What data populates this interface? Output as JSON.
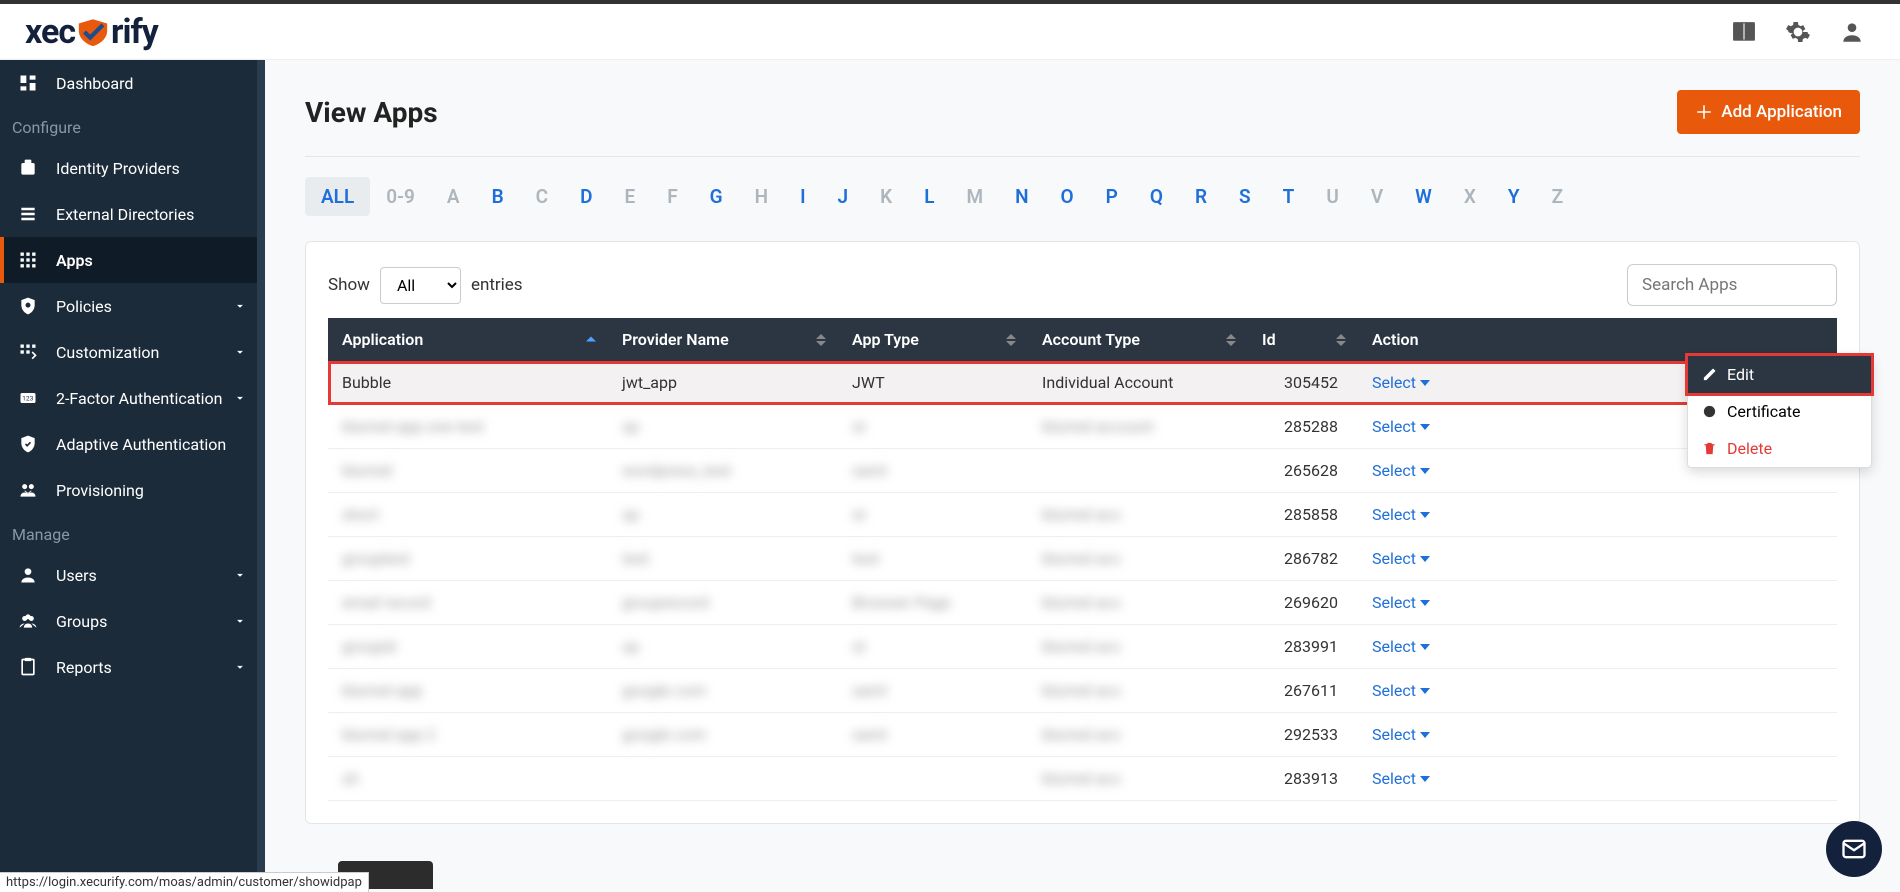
{
  "brand": "xecurify",
  "page": {
    "title": "View Apps",
    "add_btn": "Add Application"
  },
  "sidebar": {
    "items": [
      {
        "label": "Dashboard",
        "name": "dashboard"
      },
      {
        "section": "Configure"
      },
      {
        "label": "Identity Providers",
        "name": "identity-providers"
      },
      {
        "label": "External Directories",
        "name": "external-directories"
      },
      {
        "label": "Apps",
        "name": "apps",
        "active": true
      },
      {
        "label": "Policies",
        "name": "policies",
        "expandable": true
      },
      {
        "label": "Customization",
        "name": "customization",
        "expandable": true
      },
      {
        "label": "2-Factor Authentication",
        "name": "two-factor",
        "expandable": true
      },
      {
        "label": "Adaptive Authentication",
        "name": "adaptive-auth"
      },
      {
        "label": "Provisioning",
        "name": "provisioning"
      },
      {
        "section": "Manage"
      },
      {
        "label": "Users",
        "name": "users",
        "expandable": true
      },
      {
        "label": "Groups",
        "name": "groups",
        "expandable": true
      },
      {
        "label": "Reports",
        "name": "reports",
        "expandable": true
      }
    ]
  },
  "alpha": {
    "items": [
      "ALL",
      "0-9",
      "A",
      "B",
      "C",
      "D",
      "E",
      "F",
      "G",
      "H",
      "I",
      "J",
      "K",
      "L",
      "M",
      "N",
      "O",
      "P",
      "Q",
      "R",
      "S",
      "T",
      "U",
      "V",
      "W",
      "X",
      "Y",
      "Z"
    ],
    "selected": "ALL",
    "disabled": [
      "0-9",
      "A",
      "C",
      "E",
      "F",
      "H",
      "K",
      "M",
      "U",
      "V",
      "X",
      "Z"
    ]
  },
  "table": {
    "show_label": "Show",
    "entries_label": "entries",
    "show_value": "All",
    "search_placeholder": "Search Apps",
    "headers": [
      "Application",
      "Provider Name",
      "App Type",
      "Account Type",
      "Id",
      "Action"
    ],
    "select_label": "Select",
    "rows": [
      {
        "app": "Bubble",
        "provider": "jwt_app",
        "type": "JWT",
        "account": "Individual Account",
        "id": "305452",
        "hl": true
      },
      {
        "app": "blurred app one text",
        "provider": "sp",
        "type": "st",
        "account": "blurred account",
        "id": "285288",
        "b": true
      },
      {
        "app": "blurred",
        "provider": "wordpress_test",
        "type": "saml",
        "account": "",
        "id": "265628",
        "b": true
      },
      {
        "app": "short",
        "provider": "sp",
        "type": "st",
        "account": "blurred acc",
        "id": "285858",
        "b": true
      },
      {
        "app": "grouptext",
        "provider": "test",
        "type": "test",
        "account": "blurred acc",
        "id": "286782",
        "b": true
      },
      {
        "app": "email record",
        "provider": "grouprecord",
        "type": "Browser Page",
        "account": "blurred acc",
        "id": "269620",
        "b": true
      },
      {
        "app": "groupid",
        "provider": "sp",
        "type": "st",
        "account": "blurred acc",
        "id": "283991",
        "b": true
      },
      {
        "app": "blurred app",
        "provider": "google com",
        "type": "saml",
        "account": "blurred acc",
        "id": "267611",
        "b": true
      },
      {
        "app": "blurred app 2",
        "provider": "google com",
        "type": "saml",
        "account": "blurred acc",
        "id": "292533",
        "b": true
      },
      {
        "app": "sh",
        "provider": "",
        "type": "",
        "account": "blurred acc",
        "id": "283913",
        "b": true
      }
    ]
  },
  "dropdown": {
    "edit": "Edit",
    "cert": "Certificate",
    "del": "Delete"
  },
  "status_url": "https://login.xecurify.com/moas/admin/customer/showidpap"
}
